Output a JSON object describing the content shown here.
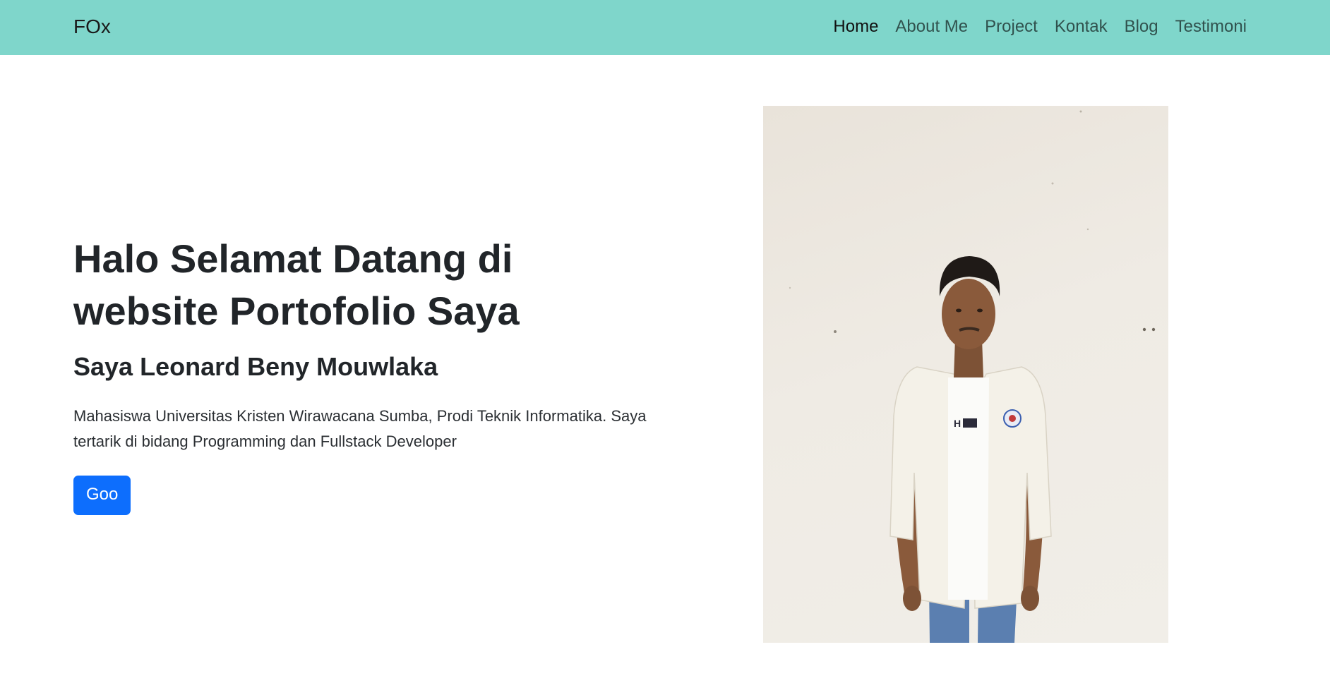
{
  "navbar": {
    "brand": "FOx",
    "items": [
      {
        "label": "Home",
        "active": true
      },
      {
        "label": "About Me",
        "active": false
      },
      {
        "label": "Project",
        "active": false
      },
      {
        "label": "Kontak",
        "active": false
      },
      {
        "label": "Blog",
        "active": false
      },
      {
        "label": "Testimoni",
        "active": false
      }
    ],
    "background_color": "#7fd6cb"
  },
  "hero": {
    "title": "Halo Selamat Datang di website Portofolio Saya",
    "subtitle": "Saya Leonard Beny Mouwlaka",
    "description": "Mahasiswa Universitas Kristen Wirawacana Sumba, Prodi Teknik Informatika. Saya tertarik di bidang Programming dan Fullstack Developer",
    "button_label": "Goo",
    "button_color": "#0d6efd"
  }
}
